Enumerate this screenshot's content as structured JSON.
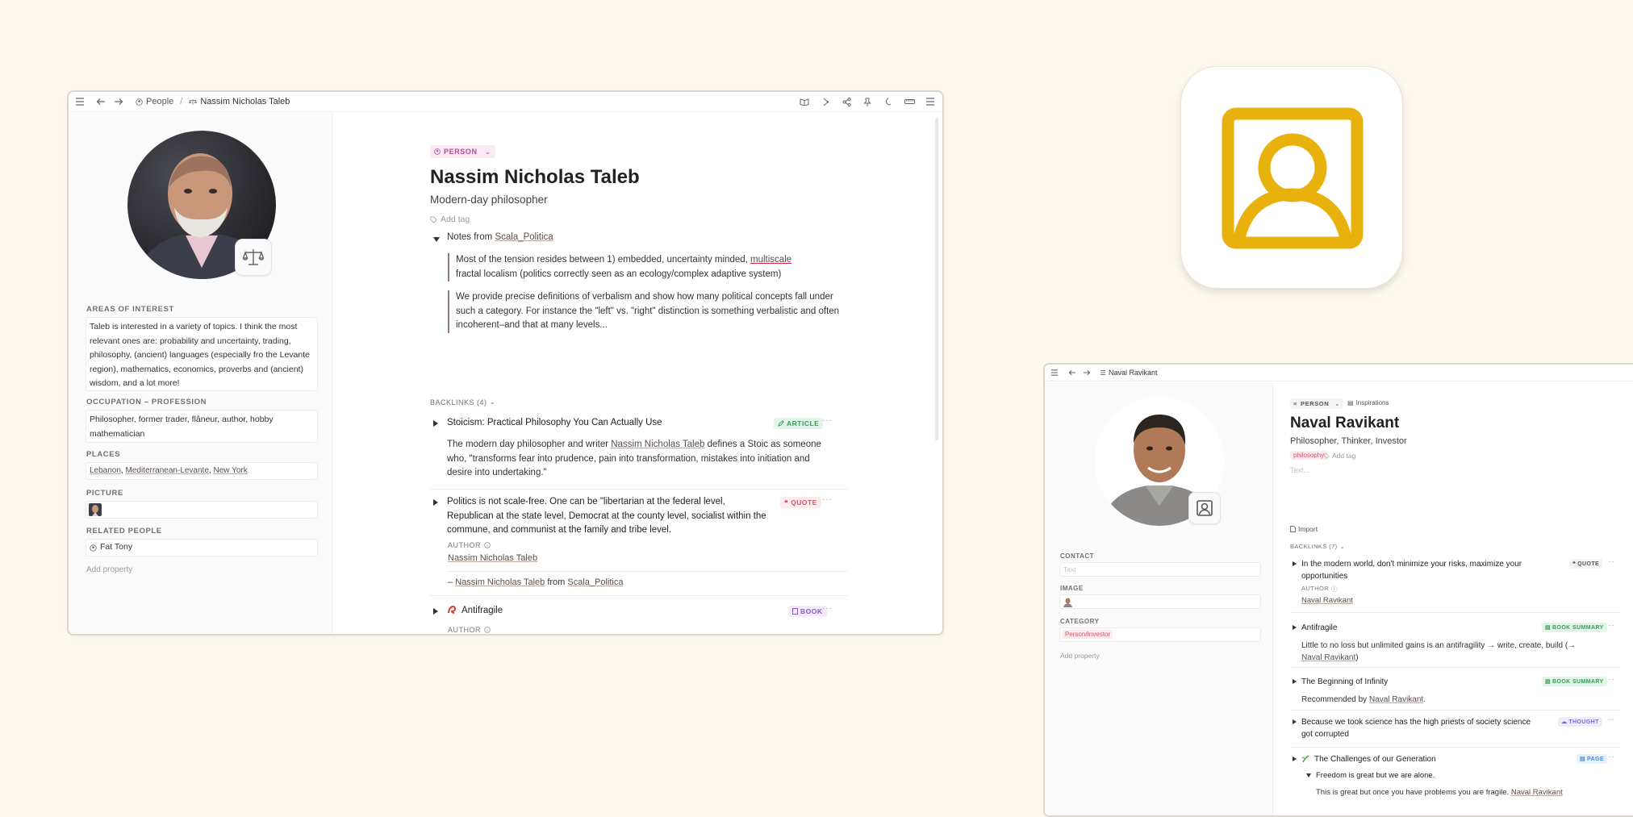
{
  "window1": {
    "breadcrumb": {
      "parent": "People",
      "separator": "/",
      "current": "Nassim Nicholas Taleb"
    },
    "sidebar": {
      "areas_label": "AREAS OF INTEREST",
      "areas_text": "Taleb is interested in a variety of topics. I think the most relevant ones are: probability and uncertainty, trading, philosophy, (ancient) languages (especially fro the Levante region), mathematics, economics, proverbs and (ancient) wisdom, and a lot more!",
      "occupation_label": "OCCUPATION – PROFESSION",
      "occupation_text": "Philosopher, former trader, flâneur, author, hobby mathematician",
      "places_label": "PLACES",
      "places": [
        "Lebanon",
        "Mediterranean-Levante",
        "New York"
      ],
      "places_sep": ", ",
      "picture_label": "PICTURE",
      "related_label": "RELATED PEOPLE",
      "related_person": "Fat Tony",
      "add_property": "Add property"
    },
    "main": {
      "type_pill": "PERSON",
      "title": "Nassim Nicholas Taleb",
      "subtitle": "Modern-day philosopher",
      "add_tag": "Add tag",
      "notes_prefix": "Notes from",
      "notes_source": "Scala_Politica",
      "quote1_a": "Most of the tension resides between 1) embedded, uncertainty minded, ",
      "quote1_link": "multiscale",
      "quote1_b": "fractal localism (politics correctly seen as an ecology/complex adaptive system)",
      "quote2": "We provide precise definitions of verbalism and show how many political concepts fall under such a category. For instance the \"left\" vs. \"right\" distinction is something verbalistic and often incoherent–and that at many levels...",
      "backlinks_label": "BACKLINKS (4)",
      "bl1_title": "Stoicism: Practical Philosophy You Can Actually Use",
      "bl1_tag": "ARTICLE",
      "bl1_text_a": "The modern day philosopher and writer ",
      "bl1_link": "Nassim Nicholas Taleb",
      "bl1_text_b": " defines a Stoic as someone who, \"transforms fear into prudence, pain into transformation, mistakes into initiation and desire into undertaking.\"",
      "bl2_title": "Politics is not scale-free. One can be \"libertarian at the federal level, Republican at the state level, Democrat at the county level, socialist within the commune, and communist at the family and tribe level.",
      "bl2_tag": "QUOTE",
      "author_label": "AUTHOR",
      "bl2_author": "Nassim Nicholas Taleb",
      "bl2_dash": "–",
      "bl2_from_person": "Nassim Nicholas Taleb",
      "bl2_from_word": "from",
      "bl2_from_source": "Scala_Politica",
      "bl3_title": "Antifragile",
      "bl3_tag": "BOOK",
      "more": "···"
    }
  },
  "window2": {
    "breadcrumb": "Naval Ravikant",
    "sidebar": {
      "contact_label": "CONTACT",
      "contact_placeholder": "Text",
      "image_label": "IMAGE",
      "category_label": "CATEGORY",
      "category_value": "Person/Investor",
      "add_property": "Add property"
    },
    "main": {
      "type_pill": "PERSON",
      "inspirations": "Inspirations",
      "title": "Naval Ravikant",
      "subtitle": "Philosopher, Thinker, Investor",
      "tag": "philosophy",
      "add_tag": "Add tag",
      "text_placeholder": "Text...",
      "import": "Import",
      "backlinks_label": "BACKLINKS (7)",
      "bl1_title": "In the modern world, don't minimize your risks, maximize your opportunities",
      "bl1_tag": "QUOTE",
      "author_label": "AUTHOR",
      "bl1_author": "Naval Ravikant",
      "bl2_title": "Antifragile",
      "bl2_tag": "BOOK SUMMARY",
      "bl2_text": "Little to no loss but unlimited gains is an antifragility → write, create, build (→",
      "bl2_link": "Naval Ravikant",
      "bl2_close": ")",
      "bl3_title": "The Beginning of Infinity",
      "bl3_tag": "BOOK SUMMARY",
      "bl3_text": "Recommended by",
      "bl3_link": "Naval Ravikant",
      "bl3_period": ".",
      "bl4_title": "Because we took science has the high priests of society science got corrupted",
      "bl4_tag": "THOUGHT",
      "bl5_title": "The Challenges of our Generation",
      "bl5_tag": "PAGE",
      "bl5_sub": "Freedom is great but we are alone.",
      "bl5_text": "This is great but once you have problems you are fragile.",
      "bl5_link": "Naval Ravikant",
      "more": "···"
    }
  },
  "colors": {
    "accent_yellow": "#e8b10c",
    "background": "#fdf9ee"
  }
}
